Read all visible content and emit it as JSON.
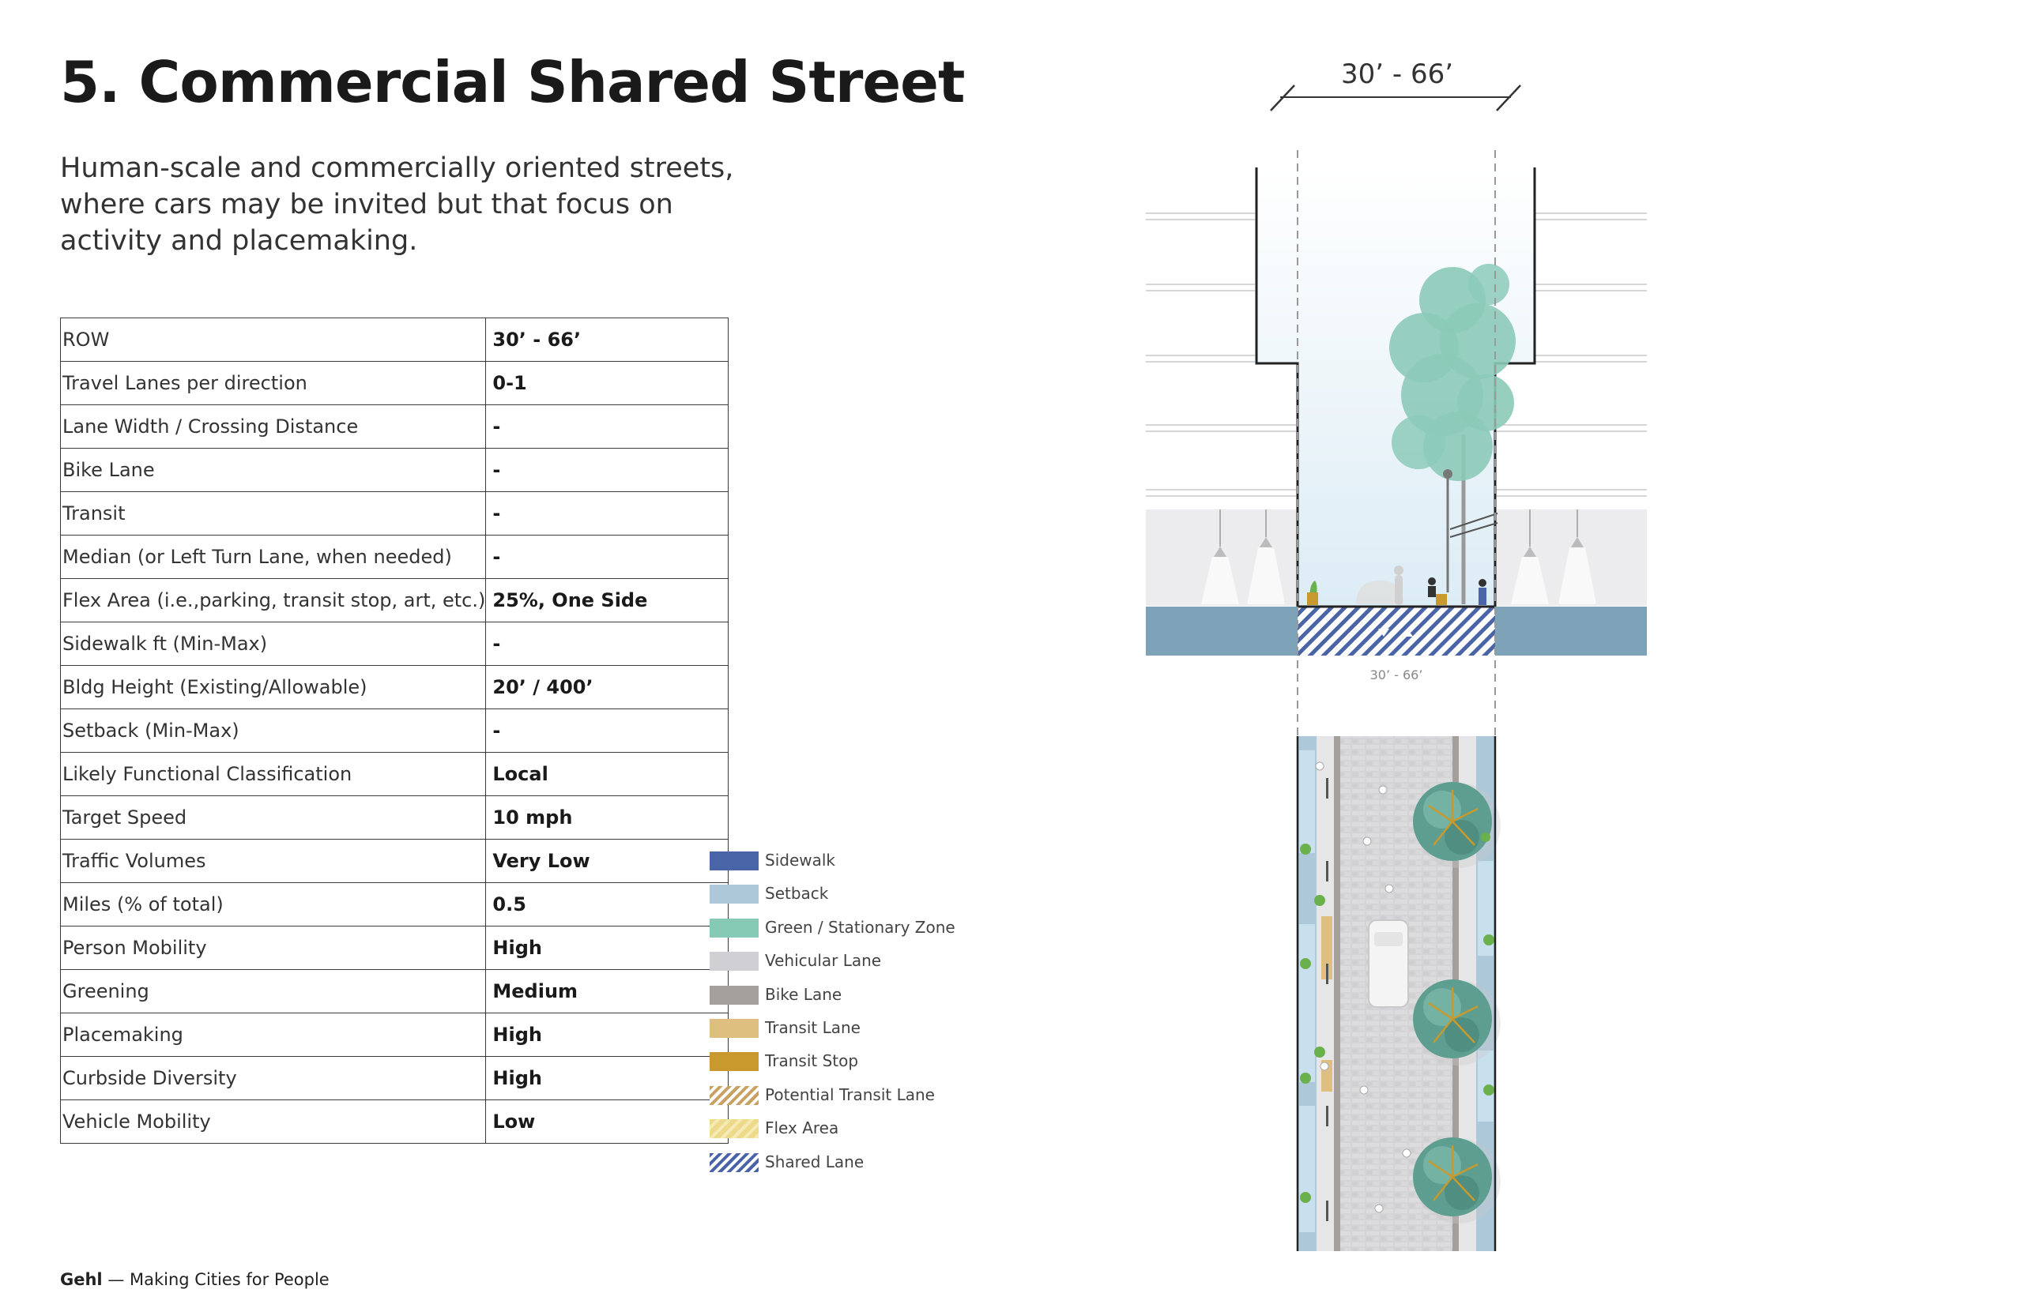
{
  "page": {
    "title": "5. Commercial Shared Street",
    "subtitle": "Human-scale and commercially oriented streets, where cars may be invited but that focus on activity and placemaking."
  },
  "attributes": [
    {
      "label": "ROW",
      "value": "30’ - 66’"
    },
    {
      "label": "Travel Lanes per direction",
      "value": "0-1"
    },
    {
      "label": "Lane Width / Crossing Distance",
      "value": "-"
    },
    {
      "label": "Bike Lane",
      "value": "-"
    },
    {
      "label": "Transit",
      "value": "-"
    },
    {
      "label": "Median (or Left Turn Lane, when needed)",
      "value": "-"
    },
    {
      "label": "Flex Area (i.e.,parking, transit stop, art, etc.)",
      "value": "25%, One Side"
    },
    {
      "label": "Sidewalk ft (Min-Max)",
      "value": "-"
    },
    {
      "label": "Bldg Height (Existing/Allowable)",
      "value": "20’ / 400’"
    },
    {
      "label": "Setback (Min-Max)",
      "value": "-"
    },
    {
      "label": "Likely Functional Classification",
      "value": "Local"
    },
    {
      "label": "Target Speed",
      "value": "10 mph"
    },
    {
      "label": "Traffic Volumes",
      "value": "Very Low"
    },
    {
      "label": "Miles (% of total)",
      "value": "0.5"
    },
    {
      "label": "Person Mobility",
      "value": "High"
    },
    {
      "label": "Greening",
      "value": "Medium"
    },
    {
      "label": "Placemaking",
      "value": "High"
    },
    {
      "label": "Curbside Diversity",
      "value": "High"
    },
    {
      "label": "Vehicle Mobility",
      "value": "Low"
    }
  ],
  "legend": [
    {
      "label": "Sidewalk",
      "color": "#4a64a8",
      "pattern": "solid"
    },
    {
      "label": "Setback",
      "color": "#adc8d9",
      "pattern": "solid"
    },
    {
      "label": "Green / Stationary Zone",
      "color": "#86c9b4",
      "pattern": "solid"
    },
    {
      "label": "Vehicular Lane",
      "color": "#d0d0d4",
      "pattern": "solid"
    },
    {
      "label": "Bike Lane",
      "color": "#a59f9c",
      "pattern": "solid"
    },
    {
      "label": "Transit Lane",
      "color": "#dfbf80",
      "pattern": "solid"
    },
    {
      "label": "Transit Stop",
      "color": "#c89a2e",
      "pattern": "solid"
    },
    {
      "label": "Potential Transit Lane",
      "color": "#c9a060",
      "pattern": "hatch"
    },
    {
      "label": "Flex Area",
      "color": "#ecd98a",
      "pattern": "wave"
    },
    {
      "label": "Shared Lane",
      "color": "#4a64a8",
      "pattern": "hatch"
    }
  ],
  "diagram": {
    "row_dimension_top": "30’ - 66’",
    "row_dimension_section": "30’ - 66’"
  },
  "footer": {
    "brand": "Gehl",
    "tagline": " — Making Cities for People"
  },
  "colors": {
    "street_base": "#7ea2b8",
    "sky_top": "#ffffff",
    "sky_bottom": "#dcecf5",
    "tree": "#8ccab8",
    "planter_green": "#6ab04c"
  }
}
